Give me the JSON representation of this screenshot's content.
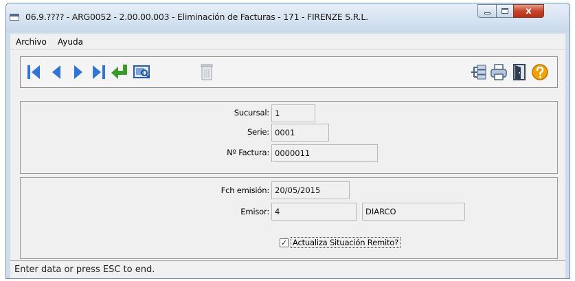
{
  "window": {
    "title": "06.9.???? - ARG0052 - 2.00.00.003 - Eliminación de Facturas - 171 - FIRENZE S.R.L.",
    "close_glyph": "x"
  },
  "menu": [
    {
      "label": "Archivo"
    },
    {
      "label": "Ayuda"
    }
  ],
  "toolbar": {
    "left_icons": [
      "first-record-icon",
      "previous-record-icon",
      "next-record-icon",
      "last-record-icon",
      "enter-icon",
      "search-icon",
      "delete-icon"
    ],
    "right_icons": [
      "tree-icon",
      "print-icon",
      "exit-icon",
      "help-icon"
    ]
  },
  "form": {
    "sucursal": {
      "label": "Sucursal:",
      "value": "1"
    },
    "serie": {
      "label": "Serie:",
      "value": "0001"
    },
    "factura": {
      "label": "Nº Factura:",
      "value": "0000011"
    },
    "fecha": {
      "label": "Fch emisión:",
      "value": "20/05/2015"
    },
    "emisor": {
      "label": "Emisor:",
      "code": "4",
      "name": "DIARCO"
    },
    "actualiza": {
      "label": "Actualiza Situación Remito?",
      "checked": true,
      "mark": "✓"
    }
  },
  "status": {
    "text": "Enter data or press ESC to end."
  },
  "colors": {
    "nav_blue": "#2f74d6",
    "enter_green": "#3a9a2a",
    "help_orange": "#f0a000"
  }
}
